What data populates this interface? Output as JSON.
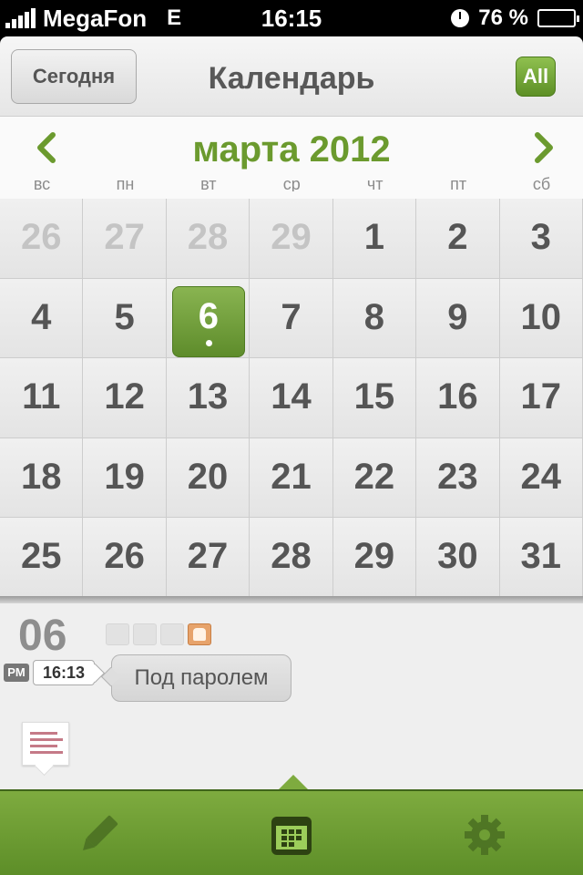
{
  "status_bar": {
    "carrier": "MegaFon",
    "network": "E",
    "time": "16:15",
    "battery": "76 %",
    "battery_level": 0.76
  },
  "nav": {
    "today_label": "Сегодня",
    "title": "Календарь",
    "all_label": "All"
  },
  "month": {
    "title": "марта 2012",
    "weekdays": [
      "вс",
      "пн",
      "вт",
      "ср",
      "чт",
      "пт",
      "сб"
    ]
  },
  "calendar": {
    "rows": [
      [
        "26",
        "27",
        "28",
        "29",
        "1",
        "2",
        "3"
      ],
      [
        "4",
        "5",
        "6",
        "7",
        "8",
        "9",
        "10"
      ],
      [
        "11",
        "12",
        "13",
        "14",
        "15",
        "16",
        "17"
      ],
      [
        "18",
        "19",
        "20",
        "21",
        "22",
        "23",
        "24"
      ],
      [
        "25",
        "26",
        "27",
        "28",
        "29",
        "30",
        "31"
      ]
    ],
    "selected": "6"
  },
  "day": {
    "number": "06",
    "entry": {
      "period": "PM",
      "time": "16:13",
      "text": "Под паролем"
    }
  },
  "tabbar": {
    "tabs": [
      "pencil-icon",
      "calendar-icon",
      "gear-icon"
    ],
    "active": "calendar-icon"
  },
  "colors": {
    "accent_green": "#6b9a2e",
    "tabbar_green": "#6f9e35",
    "note_lines": "#c57a87",
    "lock_orange": "#e7a36b"
  }
}
